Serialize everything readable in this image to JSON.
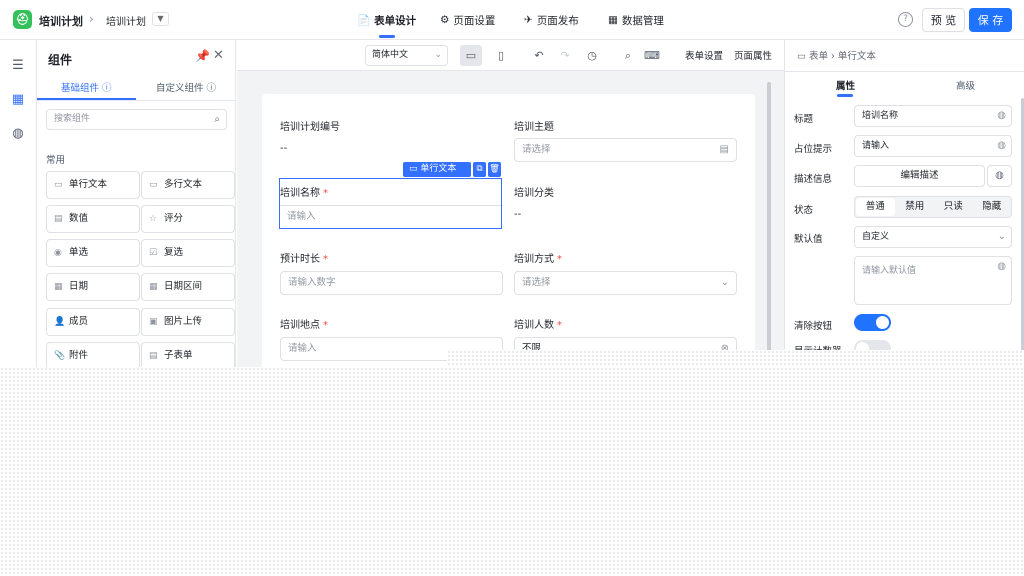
{
  "topbar": {
    "logo_glyph": "⛑",
    "app_name": "培训计划",
    "breadcrumb_sep": "›",
    "page_name": "培训计划",
    "nav": [
      {
        "icon": "📄",
        "label": "表单设计"
      },
      {
        "icon": "⚙",
        "label": "页面设置"
      },
      {
        "icon": "✈",
        "label": "页面发布"
      },
      {
        "icon": "▦",
        "label": "数据管理"
      }
    ],
    "help": "?",
    "preview": "预 览",
    "save": "保 存"
  },
  "panel": {
    "title": "组件",
    "tabs": [
      "基础组件",
      "自定义组件"
    ],
    "search_placeholder": "搜索组件",
    "group": "常用",
    "components": [
      {
        "icon": "▭",
        "label": "单行文本"
      },
      {
        "icon": "▭",
        "label": "多行文本"
      },
      {
        "icon": "▤",
        "label": "数值"
      },
      {
        "icon": "☆",
        "label": "评分"
      },
      {
        "icon": "◉",
        "label": "单选"
      },
      {
        "icon": "☑",
        "label": "复选"
      },
      {
        "icon": "▦",
        "label": "日期"
      },
      {
        "icon": "▦",
        "label": "日期区间"
      },
      {
        "icon": "👤",
        "label": "成员"
      },
      {
        "icon": "▣",
        "label": "图片上传"
      },
      {
        "icon": "📎",
        "label": "附件"
      },
      {
        "icon": "▤",
        "label": "子表单"
      }
    ]
  },
  "toolbar": {
    "language": "简体中文",
    "form_settings": "表单设置",
    "page_properties": "页面属性"
  },
  "form": {
    "fields": [
      {
        "label": "培训计划编号",
        "value": "--"
      },
      {
        "label": "培训主题",
        "placeholder": "请选择"
      },
      {
        "label": "培训名称",
        "required": "*",
        "placeholder": "请输入"
      },
      {
        "label": "培训分类",
        "value": "--"
      },
      {
        "label": "预计时长",
        "required": "*",
        "placeholder": "请输入数字"
      },
      {
        "label": "培训方式",
        "required": "*",
        "placeholder": "请选择"
      },
      {
        "label": "培训地点",
        "required": "*",
        "placeholder": "请输入"
      },
      {
        "label": "培训人数",
        "required": "*",
        "value": "不限"
      }
    ],
    "selected_tag": "单行文本"
  },
  "properties": {
    "breadcrumb": [
      "表单",
      "单行文本"
    ],
    "tabs": [
      "属性",
      "高级"
    ],
    "title_label": "标题",
    "title_value": "培训名称",
    "placeholder_label": "占位提示",
    "placeholder_value": "请输入",
    "desc_label": "描述信息",
    "desc_button": "编辑描述",
    "status_label": "状态",
    "status_options": [
      "普通",
      "禁用",
      "只读",
      "隐藏"
    ],
    "default_label": "默认值",
    "default_mode": "自定义",
    "default_placeholder": "请输入默认值",
    "clear_label": "清除按钮",
    "clear_on": true,
    "counter_label": "显示计数器",
    "counter_on": false
  }
}
